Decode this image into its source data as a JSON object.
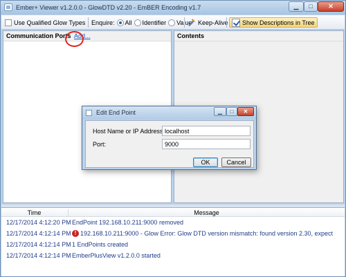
{
  "window": {
    "title": "Ember+ Viewer v1.2.0.0 - GlowDTD v2.20 - EmBER Encoding v1.7",
    "minimize_glyph": "▁",
    "maximize_glyph": "□",
    "close_glyph": "✕"
  },
  "toolbar": {
    "use_qualified_label": "Use Qualified Glow Types",
    "enquire_label": "Enquire:",
    "enquire_options": [
      "All",
      "Identifier",
      "Value"
    ],
    "enquire_selected": "All",
    "keep_alive_label": "Keep-Alive",
    "show_descriptions_label": "Show Descriptions in Tree"
  },
  "left_pane": {
    "title": "Communication Ports",
    "add_link": "Add..."
  },
  "right_pane": {
    "title": "Contents"
  },
  "log": {
    "columns": [
      "Time",
      "Message"
    ],
    "rows": [
      {
        "time": "12/17/2014 4:12:20 PM",
        "message": "EndPoint 192.168.10.211:9000 removed",
        "icon": ""
      },
      {
        "time": "12/17/2014 4:12:14 PM",
        "message": "192.168.10.211:9000 - Glow Error: Glow DTD version mismatch: found version 2.30, expect",
        "icon": "error-icon"
      },
      {
        "time": "12/17/2014 4:12:14 PM",
        "message": "1 EndPoints created",
        "icon": ""
      },
      {
        "time": "12/17/2014 4:12:14 PM",
        "message": "EmberPlusView v1.2.0.0 started",
        "icon": ""
      }
    ]
  },
  "dialog": {
    "title": "Edit End Point",
    "host_label": "Host Name or IP Address:",
    "host_value": "localhost",
    "port_label": "Port:",
    "port_value": "9000",
    "ok_label": "OK",
    "cancel_label": "Cancel"
  },
  "colors": {
    "link": "#1a55c8",
    "log_text": "#1f3c8a",
    "annotation": "#e0221b",
    "error": "#cc1f1f"
  }
}
